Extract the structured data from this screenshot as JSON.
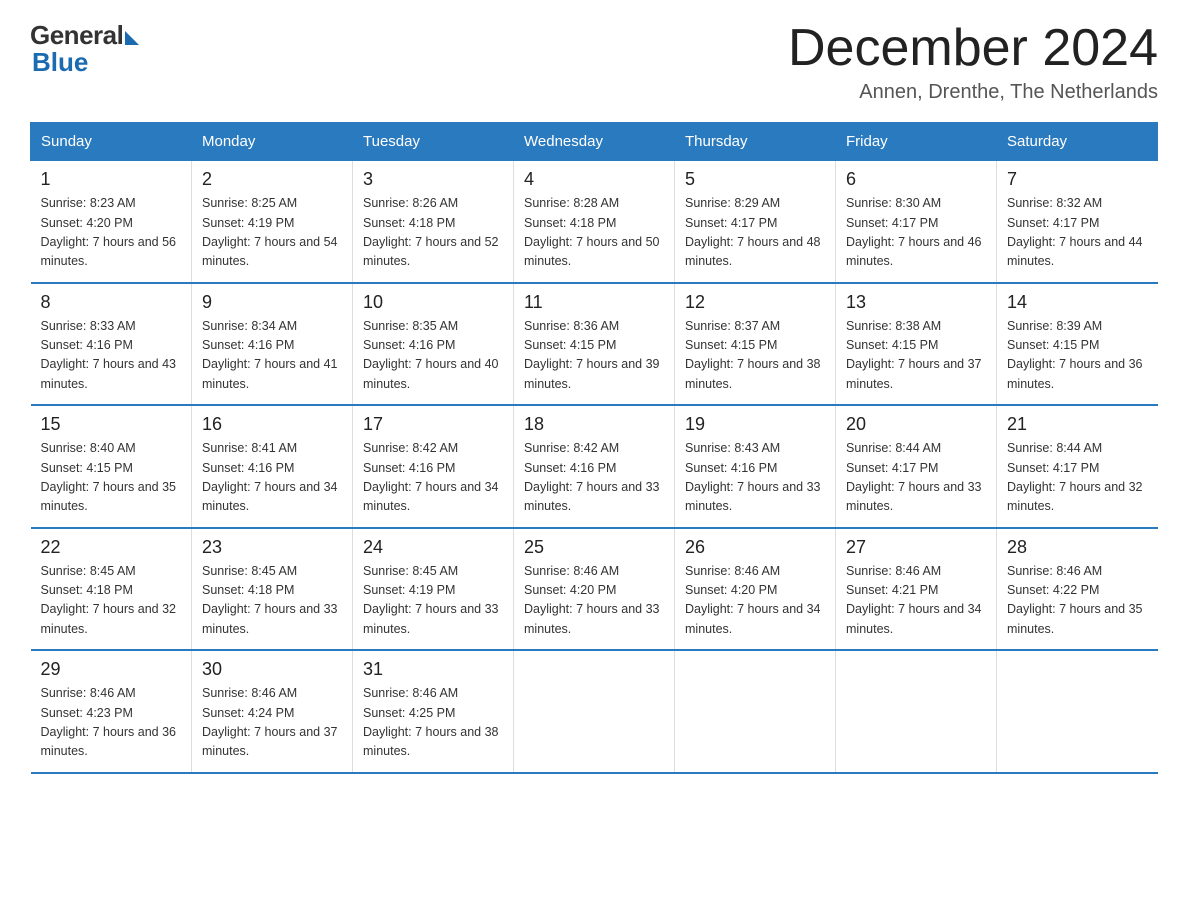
{
  "logo": {
    "general": "General",
    "blue": "Blue"
  },
  "header": {
    "title": "December 2024",
    "subtitle": "Annen, Drenthe, The Netherlands"
  },
  "days_of_week": [
    "Sunday",
    "Monday",
    "Tuesday",
    "Wednesday",
    "Thursday",
    "Friday",
    "Saturday"
  ],
  "weeks": [
    [
      {
        "day": "1",
        "sunrise": "8:23 AM",
        "sunset": "4:20 PM",
        "daylight": "7 hours and 56 minutes."
      },
      {
        "day": "2",
        "sunrise": "8:25 AM",
        "sunset": "4:19 PM",
        "daylight": "7 hours and 54 minutes."
      },
      {
        "day": "3",
        "sunrise": "8:26 AM",
        "sunset": "4:18 PM",
        "daylight": "7 hours and 52 minutes."
      },
      {
        "day": "4",
        "sunrise": "8:28 AM",
        "sunset": "4:18 PM",
        "daylight": "7 hours and 50 minutes."
      },
      {
        "day": "5",
        "sunrise": "8:29 AM",
        "sunset": "4:17 PM",
        "daylight": "7 hours and 48 minutes."
      },
      {
        "day": "6",
        "sunrise": "8:30 AM",
        "sunset": "4:17 PM",
        "daylight": "7 hours and 46 minutes."
      },
      {
        "day": "7",
        "sunrise": "8:32 AM",
        "sunset": "4:17 PM",
        "daylight": "7 hours and 44 minutes."
      }
    ],
    [
      {
        "day": "8",
        "sunrise": "8:33 AM",
        "sunset": "4:16 PM",
        "daylight": "7 hours and 43 minutes."
      },
      {
        "day": "9",
        "sunrise": "8:34 AM",
        "sunset": "4:16 PM",
        "daylight": "7 hours and 41 minutes."
      },
      {
        "day": "10",
        "sunrise": "8:35 AM",
        "sunset": "4:16 PM",
        "daylight": "7 hours and 40 minutes."
      },
      {
        "day": "11",
        "sunrise": "8:36 AM",
        "sunset": "4:15 PM",
        "daylight": "7 hours and 39 minutes."
      },
      {
        "day": "12",
        "sunrise": "8:37 AM",
        "sunset": "4:15 PM",
        "daylight": "7 hours and 38 minutes."
      },
      {
        "day": "13",
        "sunrise": "8:38 AM",
        "sunset": "4:15 PM",
        "daylight": "7 hours and 37 minutes."
      },
      {
        "day": "14",
        "sunrise": "8:39 AM",
        "sunset": "4:15 PM",
        "daylight": "7 hours and 36 minutes."
      }
    ],
    [
      {
        "day": "15",
        "sunrise": "8:40 AM",
        "sunset": "4:15 PM",
        "daylight": "7 hours and 35 minutes."
      },
      {
        "day": "16",
        "sunrise": "8:41 AM",
        "sunset": "4:16 PM",
        "daylight": "7 hours and 34 minutes."
      },
      {
        "day": "17",
        "sunrise": "8:42 AM",
        "sunset": "4:16 PM",
        "daylight": "7 hours and 34 minutes."
      },
      {
        "day": "18",
        "sunrise": "8:42 AM",
        "sunset": "4:16 PM",
        "daylight": "7 hours and 33 minutes."
      },
      {
        "day": "19",
        "sunrise": "8:43 AM",
        "sunset": "4:16 PM",
        "daylight": "7 hours and 33 minutes."
      },
      {
        "day": "20",
        "sunrise": "8:44 AM",
        "sunset": "4:17 PM",
        "daylight": "7 hours and 33 minutes."
      },
      {
        "day": "21",
        "sunrise": "8:44 AM",
        "sunset": "4:17 PM",
        "daylight": "7 hours and 32 minutes."
      }
    ],
    [
      {
        "day": "22",
        "sunrise": "8:45 AM",
        "sunset": "4:18 PM",
        "daylight": "7 hours and 32 minutes."
      },
      {
        "day": "23",
        "sunrise": "8:45 AM",
        "sunset": "4:18 PM",
        "daylight": "7 hours and 33 minutes."
      },
      {
        "day": "24",
        "sunrise": "8:45 AM",
        "sunset": "4:19 PM",
        "daylight": "7 hours and 33 minutes."
      },
      {
        "day": "25",
        "sunrise": "8:46 AM",
        "sunset": "4:20 PM",
        "daylight": "7 hours and 33 minutes."
      },
      {
        "day": "26",
        "sunrise": "8:46 AM",
        "sunset": "4:20 PM",
        "daylight": "7 hours and 34 minutes."
      },
      {
        "day": "27",
        "sunrise": "8:46 AM",
        "sunset": "4:21 PM",
        "daylight": "7 hours and 34 minutes."
      },
      {
        "day": "28",
        "sunrise": "8:46 AM",
        "sunset": "4:22 PM",
        "daylight": "7 hours and 35 minutes."
      }
    ],
    [
      {
        "day": "29",
        "sunrise": "8:46 AM",
        "sunset": "4:23 PM",
        "daylight": "7 hours and 36 minutes."
      },
      {
        "day": "30",
        "sunrise": "8:46 AM",
        "sunset": "4:24 PM",
        "daylight": "7 hours and 37 minutes."
      },
      {
        "day": "31",
        "sunrise": "8:46 AM",
        "sunset": "4:25 PM",
        "daylight": "7 hours and 38 minutes."
      },
      null,
      null,
      null,
      null
    ]
  ]
}
